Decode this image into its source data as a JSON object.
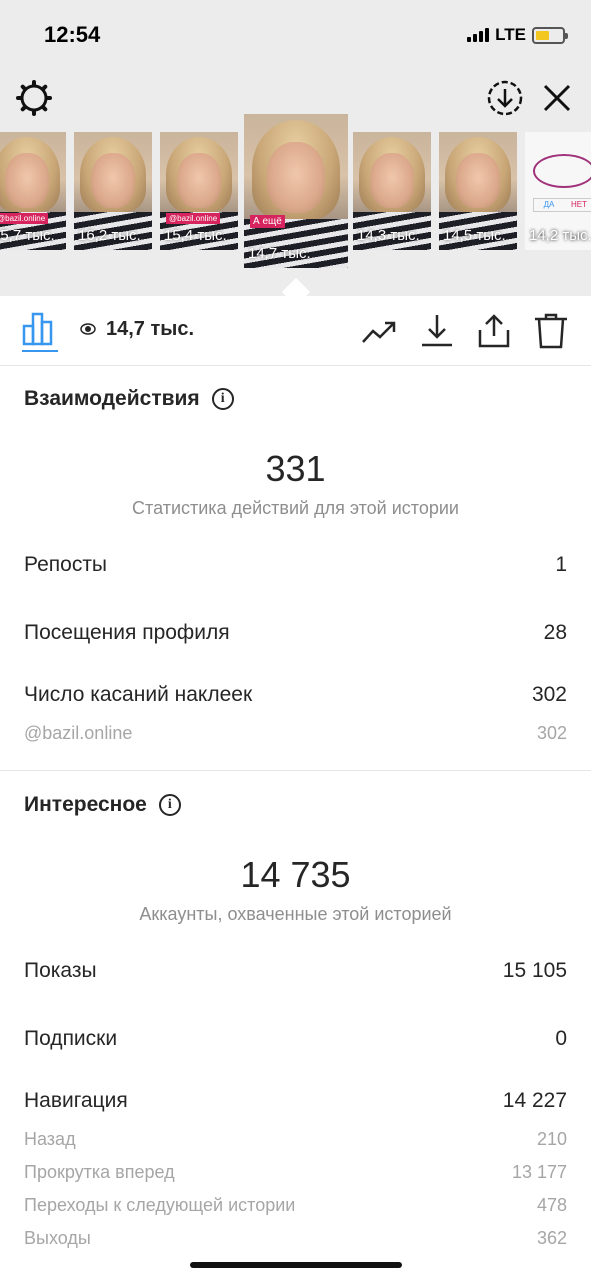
{
  "status": {
    "time": "12:54",
    "network": "LTE"
  },
  "thumbnails": [
    {
      "views": "15,7 тыс.",
      "tag": "@bazil.online",
      "selected": false
    },
    {
      "views": "16,2 тыс.",
      "tag": "",
      "selected": false
    },
    {
      "views": "15,4 тыс.",
      "tag": "@bazil.online",
      "selected": false
    },
    {
      "views": "14,7 тыс.",
      "tag": "А ещё",
      "selected": true
    },
    {
      "views": "14,3 тыс.",
      "tag": "",
      "selected": false
    },
    {
      "views": "14,5 тыс.",
      "tag": "",
      "selected": false
    },
    {
      "views": "14,2 тыс.",
      "tag": "",
      "selected": false,
      "poll": true,
      "poll_yes": "ДА",
      "poll_no": "НЕТ"
    }
  ],
  "action_bar": {
    "views": "14,7 тыс."
  },
  "interactions": {
    "title": "Взаимодействия",
    "total": "331",
    "total_caption": "Статистика действий для этой истории",
    "rows": [
      {
        "label": "Репосты",
        "value": "1"
      },
      {
        "label": "Посещения профиля",
        "value": "28"
      },
      {
        "label": "Число касаний наклеек",
        "value": "302"
      }
    ],
    "sub_rows": [
      {
        "label": "@bazil.online",
        "value": "302"
      }
    ]
  },
  "discovery": {
    "title": "Интересное",
    "total": "14 735",
    "total_caption": "Аккаунты, охваченные этой историей",
    "rows": [
      {
        "label": "Показы",
        "value": "15 105"
      },
      {
        "label": "Подписки",
        "value": "0"
      },
      {
        "label": "Навигация",
        "value": "14 227"
      }
    ],
    "sub_rows": [
      {
        "label": "Назад",
        "value": "210"
      },
      {
        "label": "Прокрутка вперед",
        "value": "13 177"
      },
      {
        "label": "Переходы к следующей истории",
        "value": "478"
      },
      {
        "label": "Выходы",
        "value": "362"
      }
    ]
  },
  "colors": {
    "accent": "#3797f0",
    "text": "#262626",
    "muted": "#8e8e8e",
    "top_bg": "#ececec"
  }
}
